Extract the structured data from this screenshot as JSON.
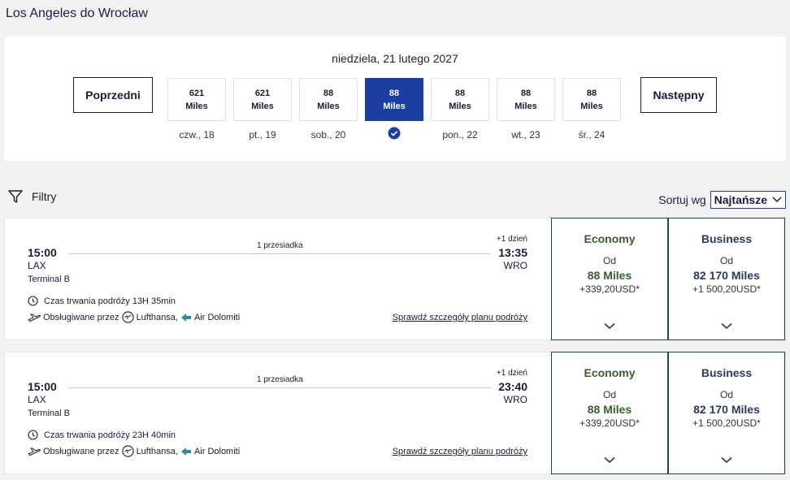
{
  "header": {
    "title": "Los Angeles do Wrocław"
  },
  "date_selector": {
    "current_date": "niedziela, 21 lutego 2027",
    "prev_label": "Poprzedni",
    "next_label": "Następny",
    "days": [
      {
        "value": "621",
        "unit": "Miles",
        "label": "czw., 18",
        "selected": false
      },
      {
        "value": "621",
        "unit": "Miles",
        "label": "pt., 19",
        "selected": false
      },
      {
        "value": "88",
        "unit": "Miles",
        "label": "sob., 20",
        "selected": false
      },
      {
        "value": "88",
        "unit": "Miles",
        "label": "",
        "selected": true
      },
      {
        "value": "88",
        "unit": "Miles",
        "label": "pon., 22",
        "selected": false
      },
      {
        "value": "88",
        "unit": "Miles",
        "label": "wt., 23",
        "selected": false
      },
      {
        "value": "88",
        "unit": "Miles",
        "label": "śr., 24",
        "selected": false
      }
    ],
    "selected_color": "#1b3fa0"
  },
  "toolbar": {
    "filters_label": "Filtry",
    "sort_label": "Sortuj wg",
    "sort_value": "Najtańsze"
  },
  "flights": [
    {
      "dep_time": "15:00",
      "dep_airport": "LAX",
      "terminal": "Terminal B",
      "stops": "1 przesiadka",
      "plus_day": "+1 dzień",
      "arr_time": "13:35",
      "arr_airport": "WRO",
      "duration": "Czas trwania podróży 13H 35min",
      "operated_by": "Obsługiwane przez",
      "carrier1": "Lufthansa,",
      "carrier2": "Air Dolomiti",
      "details_link": "Sprawdź szczegóły planu podróży",
      "fares": [
        {
          "class": "Economy",
          "from": "Od",
          "miles": "88 Miles",
          "usd": "+339,20USD*"
        },
        {
          "class": "Business",
          "from": "Od",
          "miles": "82 170 Miles",
          "usd": "+1 500,20USD*"
        }
      ]
    },
    {
      "dep_time": "15:00",
      "dep_airport": "LAX",
      "terminal": "Terminal B",
      "stops": "1 przesiadka",
      "plus_day": "+1 dzień",
      "arr_time": "23:40",
      "arr_airport": "WRO",
      "duration": "Czas trwania podróży 23H 40min",
      "operated_by": "Obsługiwane przez",
      "carrier1": "Lufthansa,",
      "carrier2": "Air Dolomiti",
      "details_link": "Sprawdź szczegóły planu podróży",
      "fares": [
        {
          "class": "Economy",
          "from": "Od",
          "miles": "88 Miles",
          "usd": "+339,20USD*"
        },
        {
          "class": "Business",
          "from": "Od",
          "miles": "82 170 Miles",
          "usd": "+1 500,20USD*"
        }
      ]
    }
  ],
  "icons": {
    "filter": "filter-icon",
    "sort_chevron": "chevron-down-icon",
    "selected_check": "check-circle-icon",
    "duration": "clock-icon",
    "plane": "plane-icon",
    "lufthansa": "lufthansa-logo-icon",
    "air_dolomiti": "air-dolomiti-logo-icon",
    "expand": "chevron-down-icon"
  }
}
